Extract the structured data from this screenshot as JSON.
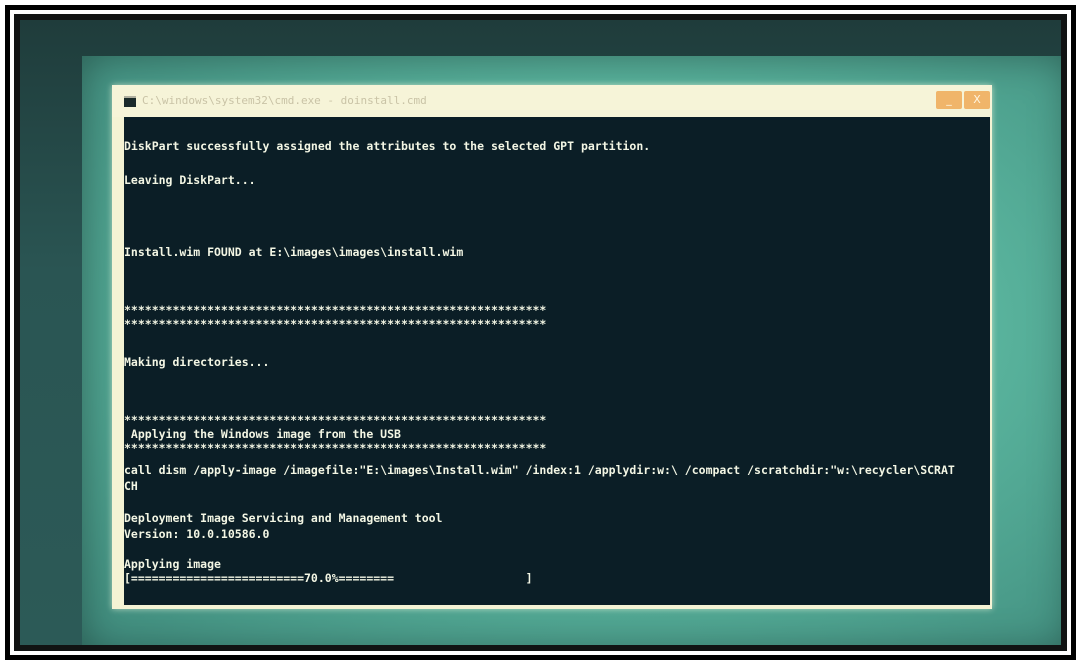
{
  "window": {
    "title": "C:\\windows\\system32\\cmd.exe - doinstall.cmd",
    "min_label": "_",
    "close_label": "X"
  },
  "console": {
    "lines": [
      "DiskPart successfully assigned the attributes to the selected GPT partition.",
      "Leaving DiskPart...",
      "Install.wim FOUND at E:\\images\\images\\install.wim",
      "*************************************************************",
      "*************************************************************",
      "Making directories...",
      "*************************************************************",
      " Applying the Windows image from the USB",
      "*************************************************************",
      "call dism /apply-image /imagefile:\"E:\\images\\Install.wim\" /index:1 /applydir:w:\\ /compact /scratchdir:\"w:\\recycler\\SCRAT",
      "CH",
      "Deployment Image Servicing and Management tool",
      "Version: 10.0.10586.0",
      "Applying image",
      "[=========================70.0%========                   ]"
    ],
    "progress_percent": 70.0
  },
  "colors": {
    "console_bg": "#0b1e26",
    "console_text": "#f3f6e4",
    "window_frame": "#f4f3d4",
    "screen_glow": "#6cc6ad"
  }
}
